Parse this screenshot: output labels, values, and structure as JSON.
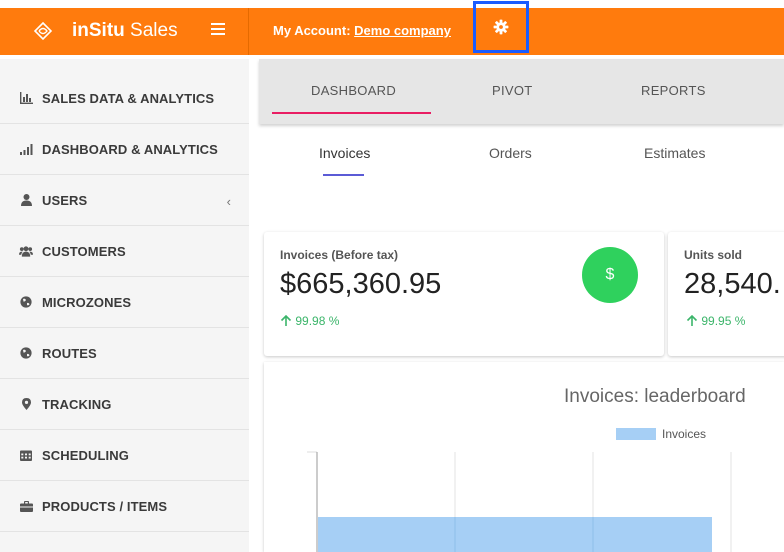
{
  "header": {
    "brand_bold": "inSitu",
    "brand_light": " Sales",
    "account_label": "My Account:",
    "account_company": "Demo company"
  },
  "sidebar": {
    "items": [
      {
        "label": "SALES DATA & ANALYTICS",
        "icon": "bar-chart-icon"
      },
      {
        "label": "DASHBOARD & ANALYTICS",
        "icon": "signal-bars-icon"
      },
      {
        "label": "USERS",
        "icon": "user-icon",
        "has_children": true
      },
      {
        "label": "CUSTOMERS",
        "icon": "users-group-icon"
      },
      {
        "label": "MICROZONES",
        "icon": "globe-icon"
      },
      {
        "label": "ROUTES",
        "icon": "globe-icon"
      },
      {
        "label": "TRACKING",
        "icon": "map-marker-icon"
      },
      {
        "label": "SCHEDULING",
        "icon": "calendar-icon"
      },
      {
        "label": "PRODUCTS / ITEMS",
        "icon": "briefcase-icon"
      }
    ]
  },
  "tabs": [
    {
      "label": "DASHBOARD",
      "active": true
    },
    {
      "label": "PIVOT",
      "active": false
    },
    {
      "label": "REPORTS",
      "active": false
    }
  ],
  "subtabs": [
    {
      "label": "Invoices",
      "active": true
    },
    {
      "label": "Orders",
      "active": false
    },
    {
      "label": "Estimates",
      "active": false
    }
  ],
  "cards": [
    {
      "label": "Invoices (Before tax)",
      "value": "$665,360.95",
      "change": "99.98 %",
      "badge": "$"
    },
    {
      "label": "Units sold",
      "value": "28,540.",
      "change": "99.95 %"
    }
  ],
  "chart": {
    "title": "Invoices: leaderboard",
    "legend": "Invoices"
  },
  "colors": {
    "header": "#ff7b0d",
    "active_tab_underline": "#e91e63",
    "subtab_underline": "#5b5bd6",
    "positive": "#3bb56a",
    "badge": "#2fd15d",
    "bar": "#a6cff5",
    "highlight_box": "#1a5cff"
  }
}
